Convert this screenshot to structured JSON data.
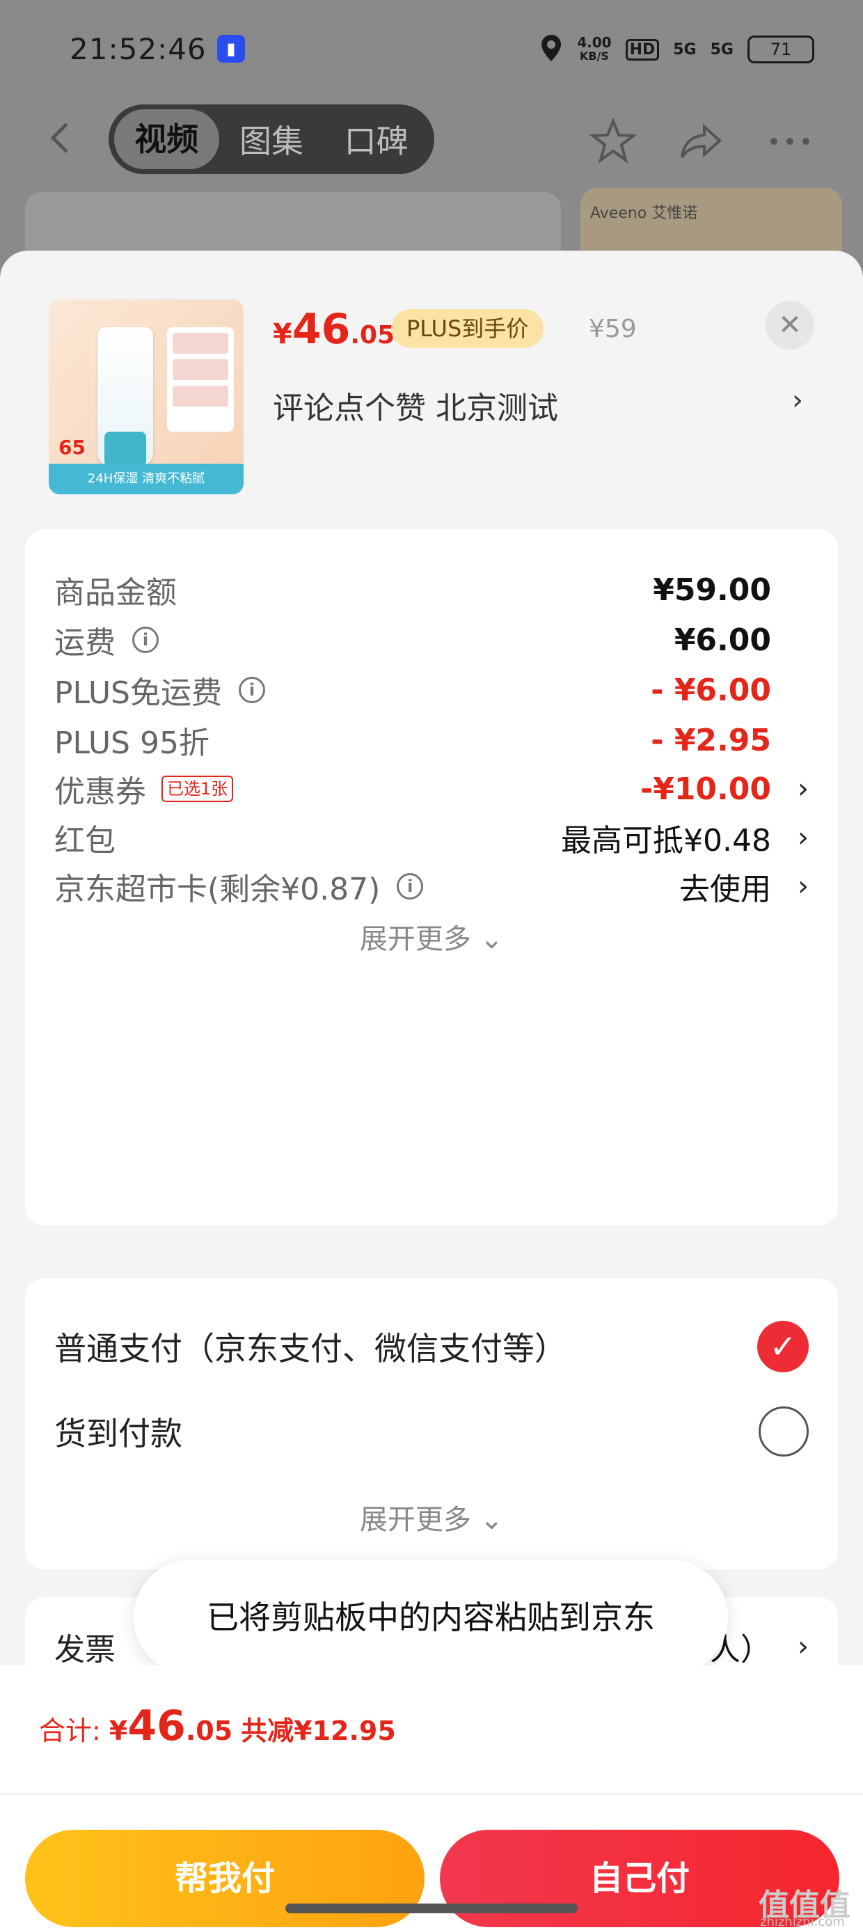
{
  "status_bar": {
    "time": "21:52:46",
    "net_speed_value": "4.00",
    "net_speed_unit": "KB/S",
    "hd_label": "HD",
    "signal1": "5G",
    "signal2": "5G",
    "battery": "71"
  },
  "bg_nav": {
    "tabs": [
      "视频",
      "图集",
      "口碑"
    ],
    "active_tab_index": 0,
    "brand_text": "Aveeno 艾惟诺"
  },
  "product": {
    "price_symbol": "¥",
    "price_int": "46",
    "price_dec": ".05",
    "plus_tag": "PLUS到手价",
    "orig_price": "¥59",
    "name": "评论点个赞  北京测试",
    "arrow": "›",
    "close": "✕",
    "thumb_price": "65",
    "thumb_banner": "24H保湿 清爽不粘腻"
  },
  "fees": {
    "rows": [
      {
        "label": "商品金额",
        "value": "¥59.00"
      },
      {
        "label": "运费",
        "value": "¥6.00"
      },
      {
        "label": "PLUS免运费",
        "value": "- ¥6.00"
      },
      {
        "label": "PLUS 95折",
        "value": "- ¥2.95"
      },
      {
        "label": "优惠券",
        "tag": "已选1张",
        "value": "-¥10.00"
      },
      {
        "label": "红包",
        "value": "最高可抵¥0.48"
      },
      {
        "label": "京东超市卡(剩余¥0.87)",
        "value": "去使用"
      }
    ],
    "expand": "展开更多 ⌄"
  },
  "payment": {
    "options": [
      {
        "label": "普通支付（京东支付、微信支付等）",
        "selected": true
      },
      {
        "label": "货到付款",
        "selected": false
      }
    ],
    "expand": "展开更多 ⌄"
  },
  "invoice": {
    "label": "发票",
    "value": "人）"
  },
  "toast": "已将剪贴板中的内容粘贴到京东",
  "bottom": {
    "total_label": "合计: ",
    "total_symbol": "¥",
    "total_int": "46",
    "total_dec": ".05",
    "discount": "共减¥12.95",
    "help_pay": "帮我付",
    "self_pay": "自己付"
  },
  "watermark": {
    "main": "值值值",
    "sub": "zhizhizhi.com"
  },
  "colors": {
    "accent_red": "#e4261a",
    "pay_yellow": "#ffb414",
    "pay_red": "#f42f3c"
  }
}
